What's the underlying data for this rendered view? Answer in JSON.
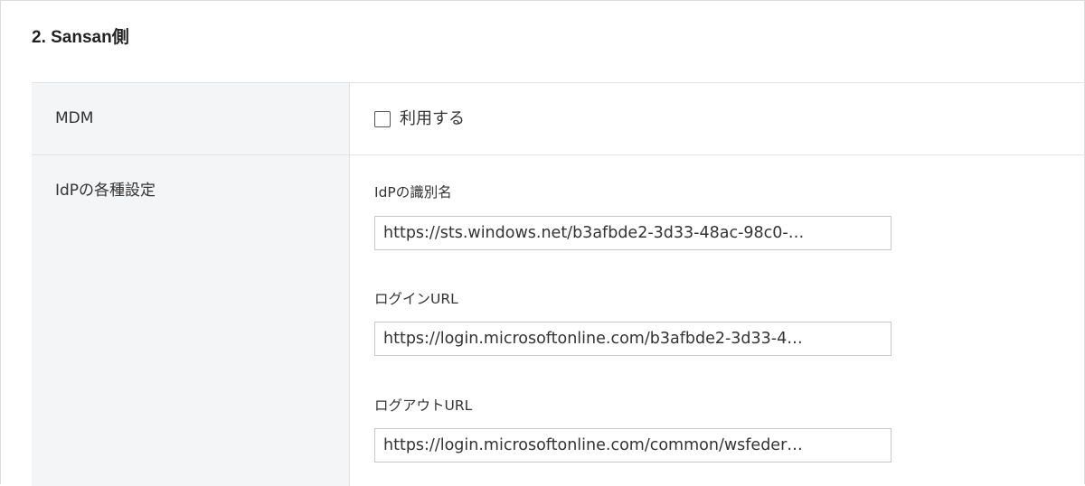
{
  "section": {
    "title": "2. Sansan側"
  },
  "rows": {
    "mdm": {
      "label": "MDM",
      "checkbox_label": "利用する",
      "checked": false
    },
    "idp": {
      "label": "IdPの各種設定",
      "fields": [
        {
          "label": "IdPの識別名",
          "value": "https://sts.windows.net/b3afbde2-3d33-48ac-98c0-…"
        },
        {
          "label": "ログインURL",
          "value": "https://login.microsoftonline.com/b3afbde2-3d33-4…"
        },
        {
          "label": "ログアウトURL",
          "value": "https://login.microsoftonline.com/common/wsfeder…"
        }
      ]
    }
  },
  "colors": {
    "label_bg": "#f4f5f7",
    "border": "#e2e2e2",
    "text": "#333333"
  }
}
